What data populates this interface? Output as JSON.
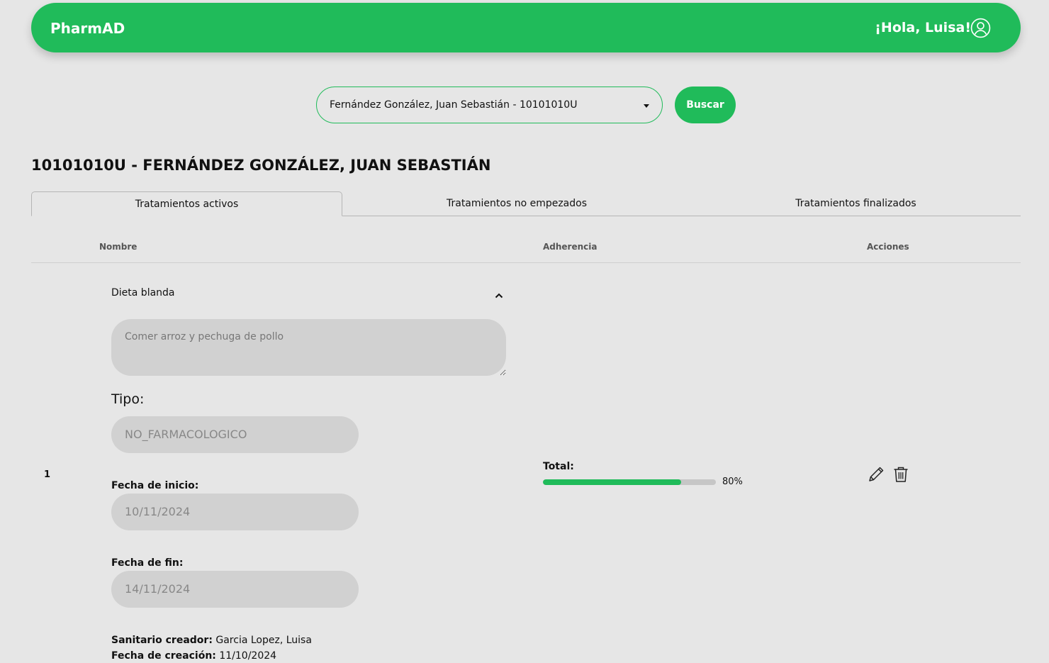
{
  "header": {
    "brand": "PharmAD",
    "greeting": "¡Hola, Luisa!",
    "user_icon": "user-circle-icon",
    "brand_color": "#20bb5a"
  },
  "search": {
    "selected_patient": "Fernández González, Juan Sebastián - 10101010U",
    "button_label": "Buscar"
  },
  "patient": {
    "title": "10101010U - FERNÁNDEZ GONZÁLEZ, JUAN SEBASTIÁN"
  },
  "tabs": [
    {
      "label": "Tratamientos activos",
      "active": true
    },
    {
      "label": "Tratamientos no empezados",
      "active": false
    },
    {
      "label": "Tratamientos finalizados",
      "active": false
    }
  ],
  "table": {
    "headers": {
      "name": "Nombre",
      "adherence": "Adherencia",
      "actions": "Acciones"
    },
    "rows": [
      {
        "index": "1",
        "name": "Dieta blanda",
        "description": "Comer arroz y pechuga de pollo",
        "tipo_label": "Tipo:",
        "tipo_value": "NO_FARMACOLOGICO",
        "start_label": "Fecha de inicio:",
        "start_value": "10/11/2024",
        "end_label": "Fecha de fin:",
        "end_value": "14/11/2024",
        "creator_label": "Sanitario creador:",
        "creator_value": "Garcia Lopez, Luisa",
        "created_label": "Fecha de creación:",
        "created_value": "11/10/2024",
        "adherence_label": "Total:",
        "adherence_percent": 80,
        "adherence_text": "80%",
        "actions": [
          "pencil-icon",
          "trash-icon"
        ]
      }
    ]
  }
}
